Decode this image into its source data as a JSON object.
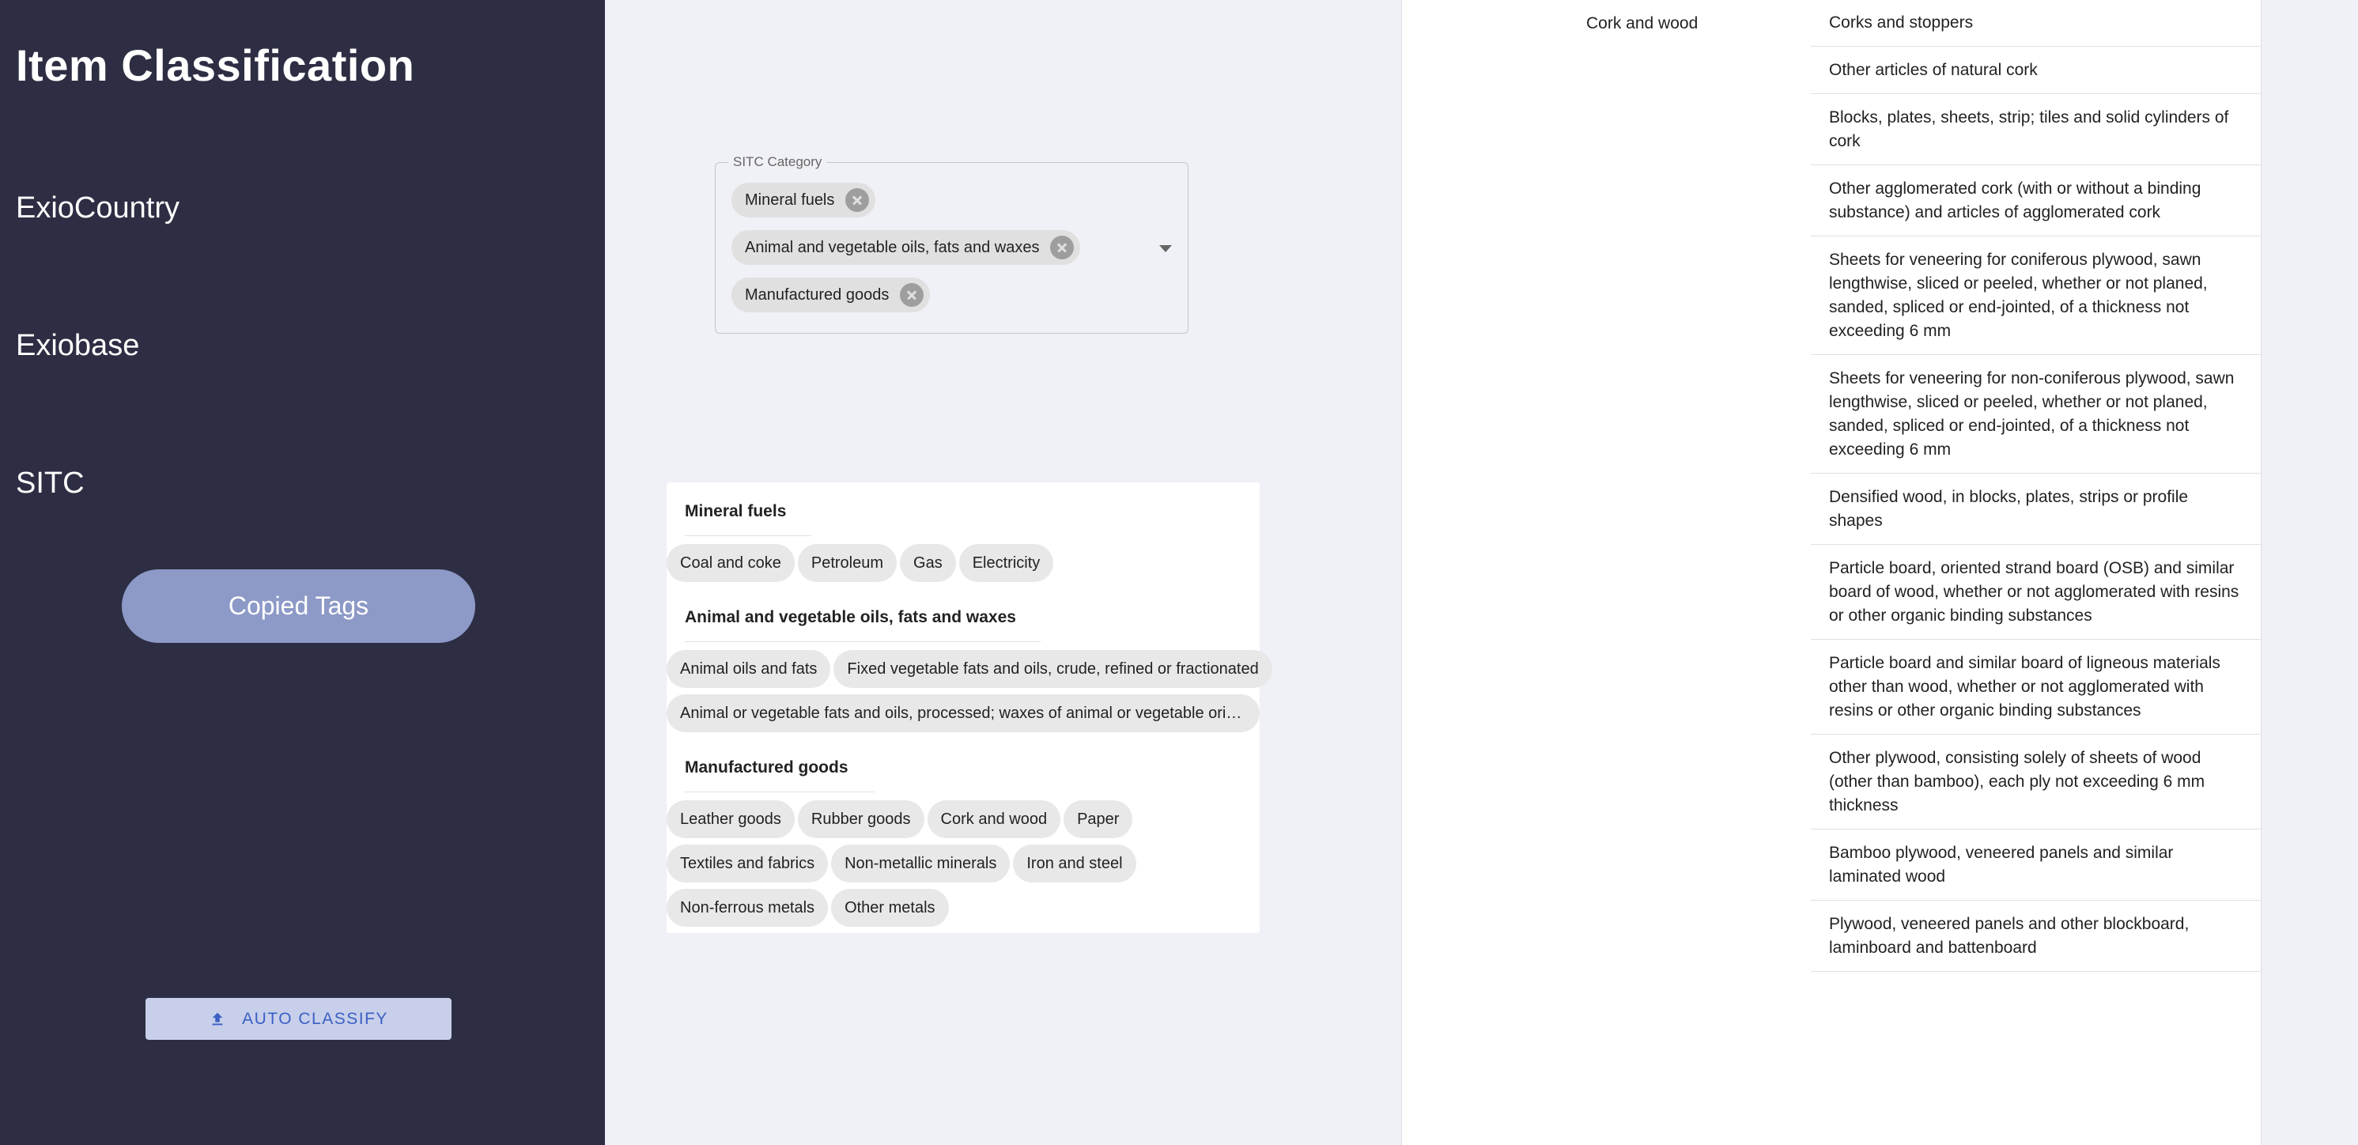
{
  "sidebar": {
    "title": "Item Classification",
    "nav": [
      "ExioCountry",
      "Exiobase",
      "SITC"
    ],
    "copied_tags_label": "Copied Tags",
    "auto_classify_label": "AUTO CLASSIFY"
  },
  "category_select": {
    "label": "SITC Category",
    "selected": [
      "Mineral fuels",
      "Animal and vegetable oils, fats and waxes",
      "Manufactured goods"
    ]
  },
  "tag_groups": [
    {
      "title": "Mineral fuels",
      "rows": [
        [
          "Coal and coke",
          "Petroleum",
          "Gas",
          "Electricity"
        ]
      ]
    },
    {
      "title": "Animal and vegetable oils, fats and waxes",
      "rows": [
        [
          "Animal oils and fats",
          "Fixed vegetable fats and oils, crude, refined or fractionated"
        ],
        [
          "Animal or vegetable fats and oils, processed; waxes of animal or vegetable origin…"
        ]
      ]
    },
    {
      "title": "Manufactured goods",
      "rows": [
        [
          "Leather goods",
          "Rubber goods",
          "Cork and wood",
          "Paper"
        ],
        [
          "Textiles and fabrics",
          "Non-metallic minerals",
          "Iron and steel"
        ],
        [
          "Non-ferrous metals",
          "Other metals"
        ]
      ]
    }
  ],
  "detail": {
    "category": "Cork and wood",
    "items": [
      "Corks and stoppers",
      "Other articles of natural cork",
      "Blocks, plates, sheets, strip; tiles and solid cylinders of cork",
      "Other agglomerated cork (with or without a binding substance) and articles of agglomerated cork",
      "Sheets for veneering for coniferous plywood, sawn lengthwise, sliced or peeled, whether or not planed, sanded, spliced or end-jointed, of a thickness not exceeding 6 mm",
      "Sheets for veneering for non-coniferous plywood, sawn lengthwise, sliced or peeled, whether or not planed, sanded, spliced or end-jointed, of a thickness not exceeding 6 mm",
      "Densified wood, in blocks, plates, strips or profile shapes",
      "Particle board, oriented strand board (OSB) and similar board of wood, whether or not agglomerated with resins or other organic binding substances",
      "Particle board and similar board of ligneous materials other than wood, whether or not agglomerated with resins or other organic binding substances",
      "Other plywood, consisting solely of sheets of wood (other than bamboo), each ply not exceeding 6 mm thickness",
      "Bamboo plywood, veneered panels and similar laminated wood",
      "Plywood, veneered panels and other blockboard, laminboard and battenboard"
    ]
  }
}
